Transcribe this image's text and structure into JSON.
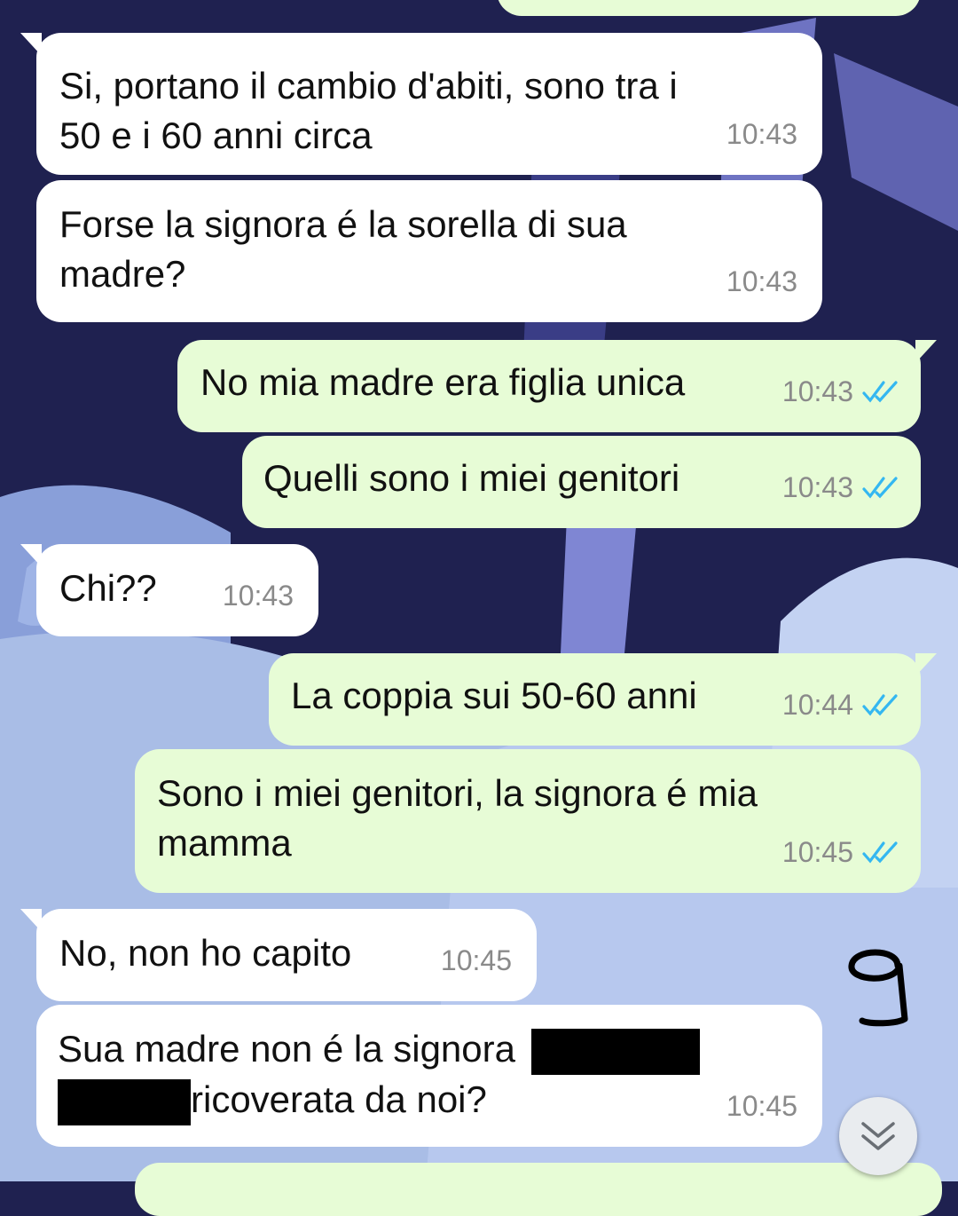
{
  "colors": {
    "incoming_bubble": "#ffffff",
    "outgoing_bubble": "#e7fcd6",
    "read_ticks": "#34b7f1",
    "timestamp": "#8a8a8a",
    "wallpaper_dark": "#1f2150",
    "wallpaper_light": "#a9bde6"
  },
  "messages": [
    {
      "direction": "incoming",
      "lines": [
        "Si, portano il cambio d'abiti, sono tra i",
        "50 e i 60 anni circa"
      ],
      "time": "10:43"
    },
    {
      "direction": "incoming",
      "lines": [
        "Forse la signora é la sorella di sua",
        "madre?"
      ],
      "time": "10:43"
    },
    {
      "direction": "outgoing",
      "lines": [
        "No mia madre era figlia unica"
      ],
      "time": "10:43",
      "status": "read"
    },
    {
      "direction": "outgoing",
      "lines": [
        "Quelli sono i miei genitori"
      ],
      "time": "10:43",
      "status": "read"
    },
    {
      "direction": "incoming",
      "lines": [
        "Chi??"
      ],
      "time": "10:43"
    },
    {
      "direction": "outgoing",
      "lines": [
        "La coppia sui 50-60 anni"
      ],
      "time": "10:44",
      "status": "read"
    },
    {
      "direction": "outgoing",
      "lines": [
        "Sono i miei genitori, la signora é mia",
        "mamma"
      ],
      "time": "10:45",
      "status": "read"
    },
    {
      "direction": "incoming",
      "lines": [
        "No, non ho capito"
      ],
      "time": "10:45"
    },
    {
      "direction": "incoming",
      "lines": [
        "Sua madre non é la signora",
        "ricoverata da noi?"
      ],
      "time": "10:45",
      "redacted": true
    }
  ],
  "annotation": "9",
  "icons": {
    "read_receipt": "double-check-icon",
    "scroll_down": "chevron-double-down-icon"
  }
}
